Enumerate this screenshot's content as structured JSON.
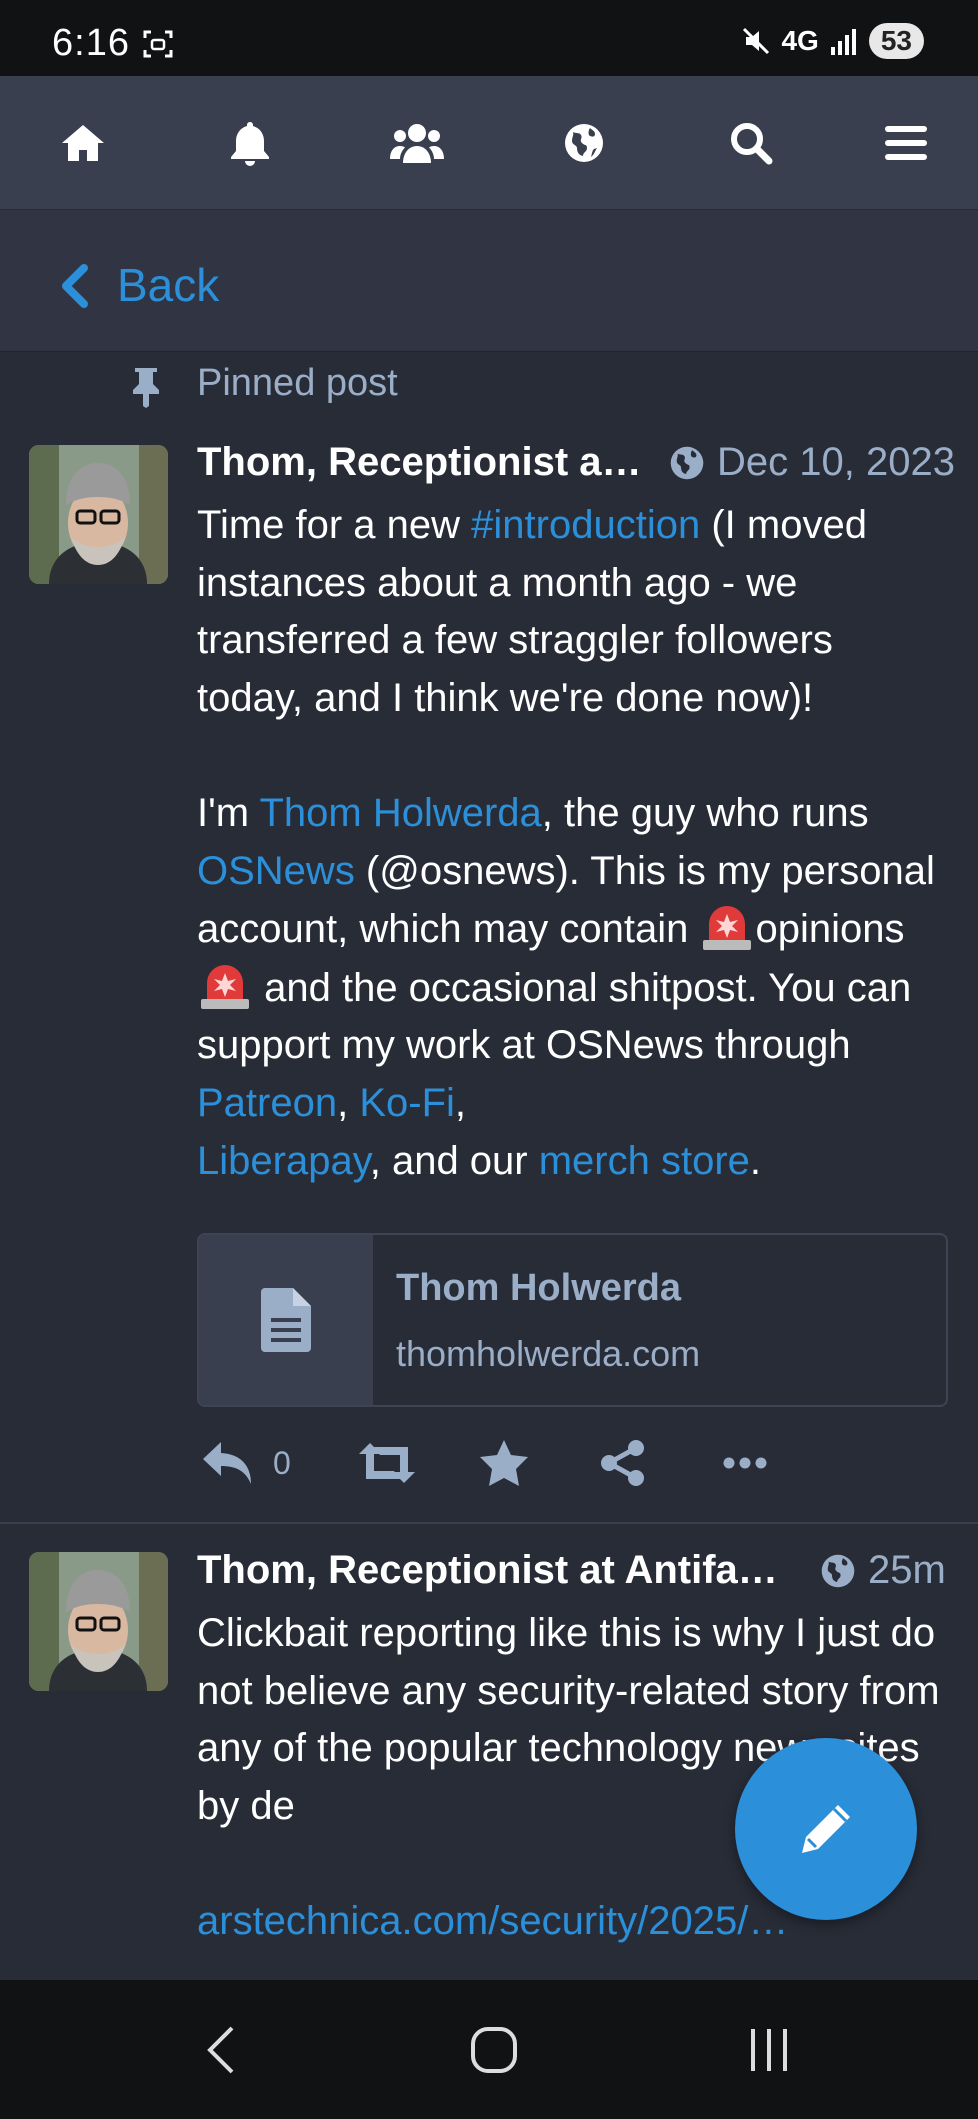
{
  "status_bar": {
    "time": "6:16",
    "network": "4G",
    "battery": "53"
  },
  "top_nav": {
    "items": [
      {
        "icon": "home-icon"
      },
      {
        "icon": "bell-icon"
      },
      {
        "icon": "users-icon"
      },
      {
        "icon": "globe-icon"
      },
      {
        "icon": "search-icon"
      },
      {
        "icon": "menu-icon"
      }
    ]
  },
  "back": {
    "label": "Back"
  },
  "pinned": {
    "label": "Pinned post"
  },
  "posts": [
    {
      "author": "Thom, Receptionist at…",
      "date": "Dec 10, 2023",
      "text": {
        "p1_a": "Time for a new ",
        "p1_hashtag": "#introduction",
        "p1_b": " (I moved instances about a month ago - we transferred a few straggler followers today, and I think we're done now)!",
        "p2_a": "I'm ",
        "p2_link_name": "Thom Holwerda",
        "p2_b": ", the guy who runs ",
        "p2_link_osnews": "OSNews",
        "p2_c": " (@osnews). This is my personal account, which may contain ",
        "p2_opinions": "opinions",
        "p2_d": " and the occasional shitpost. You can support my work at OSNews through ",
        "p2_link_patreon": "Patreon",
        "p2_comma1": ", ",
        "p2_link_kofi": "Ko-Fi",
        "p2_comma2": ",",
        "p2_link_liberapay": "Liberapay",
        "p2_e": ", and our ",
        "p2_link_merch": "merch store",
        "p2_f": "."
      },
      "card": {
        "title": "Thom Holwerda",
        "domain": "thomholwerda.com"
      },
      "replies": "0"
    },
    {
      "author": "Thom, Receptionist at Antifa®…",
      "date": "25m",
      "text": {
        "p1": "Clickbait reporting like this is why I just do not believe any security-related story from any of the popular technology news sites by de",
        "link": "arstechnica.com/security/2025/…"
      }
    }
  ],
  "colors": {
    "background": "#282c37",
    "nav": "#393f4f",
    "accent": "#2b90d9",
    "muted": "#9baec8"
  }
}
